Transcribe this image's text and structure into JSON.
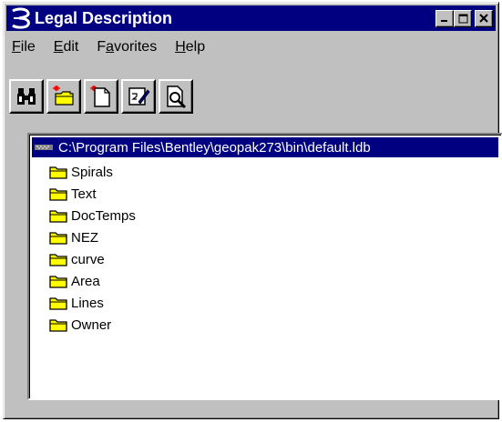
{
  "window": {
    "title": "Legal Description"
  },
  "titlebar_buttons": {
    "minimize": "_",
    "maximize": "□",
    "close": "×"
  },
  "menu": [
    {
      "label": "File",
      "hotkey": "F",
      "rest": "ile"
    },
    {
      "label": "Edit",
      "hotkey": "E",
      "rest": "dit"
    },
    {
      "label": "Favorites",
      "pre": "F",
      "hotkey": "a",
      "rest": "vorites"
    },
    {
      "label": "Help",
      "hotkey": "H",
      "rest": "elp"
    }
  ],
  "toolbar": [
    {
      "icon": "binoculars-icon",
      "name": "find-button"
    },
    {
      "icon": "new-folder-icon",
      "name": "new-folder-button"
    },
    {
      "icon": "new-document-icon",
      "name": "new-item-button"
    },
    {
      "icon": "edit-icon",
      "name": "edit-button"
    },
    {
      "icon": "preview-icon",
      "name": "preview-button"
    }
  ],
  "tree": {
    "root": "C:\\Program Files\\Bentley\\geopak273\\bin\\default.ldb",
    "folders": [
      "Spirals",
      "Text",
      "DocTemps",
      "NEZ",
      "curve",
      "Area",
      "Lines",
      "Owner"
    ]
  },
  "colors": {
    "selection": "#000080",
    "folder": "#ffff00",
    "window": "#c0c0c0"
  }
}
